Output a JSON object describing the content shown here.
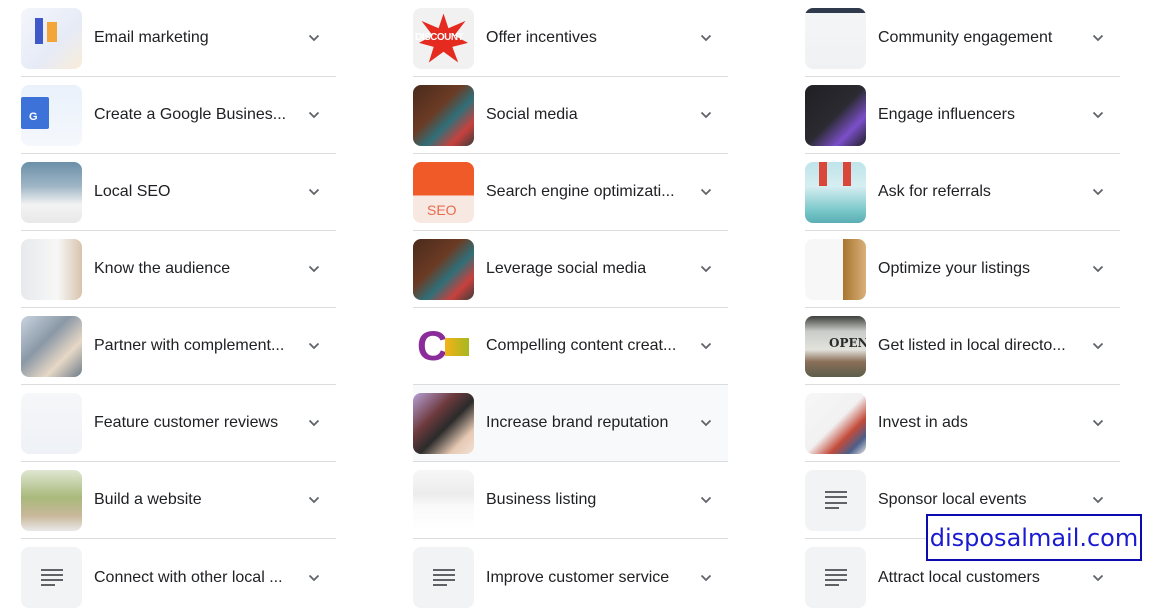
{
  "columns": [
    {
      "items": [
        {
          "label": "Email marketing",
          "thumbnail": "email-marketing-illustration"
        },
        {
          "label": "Create a Google Busines...",
          "thumbnail": "google-business-profile-logo"
        },
        {
          "label": "Local SEO",
          "thumbnail": "local-seo-video"
        },
        {
          "label": "Know the audience",
          "thumbnail": "audience-charts"
        },
        {
          "label": "Partner with complement...",
          "thumbnail": "people-handshake-photo"
        },
        {
          "label": "Feature customer reviews",
          "thumbnail": "reviews-screenshot"
        },
        {
          "label": "Build a website",
          "thumbnail": "website-screenshot"
        },
        {
          "label": "Connect with other local ...",
          "thumbnail": "document-icon"
        }
      ]
    },
    {
      "items": [
        {
          "label": "Offer incentives",
          "thumbnail": "special-discount-badge",
          "badge_text": "DISCOUNT"
        },
        {
          "label": "Social media",
          "thumbnail": "phone-social-apps"
        },
        {
          "label": "Search engine optimizati...",
          "thumbnail": "seo-guide-banner",
          "badge_text": "SEO"
        },
        {
          "label": "Leverage social media",
          "thumbnail": "phone-social-apps"
        },
        {
          "label": "Compelling content creat...",
          "thumbnail": "content-creation-logo"
        },
        {
          "label": "Increase brand reputation",
          "thumbnail": "brand-laptop-photo",
          "hovered": true
        },
        {
          "label": "Business listing",
          "thumbnail": "business-listing-screenshot"
        },
        {
          "label": "Improve customer service",
          "thumbnail": "document-icon"
        }
      ]
    },
    {
      "items": [
        {
          "label": "Community engagement",
          "thumbnail": "community-screenshot"
        },
        {
          "label": "Engage influencers",
          "thumbnail": "influencer-phone-illustration"
        },
        {
          "label": "Ask for referrals",
          "thumbnail": "referral-megaphones"
        },
        {
          "label": "Optimize your listings",
          "thumbnail": "listing-screenshot"
        },
        {
          "label": "Get listed in local directo...",
          "thumbnail": "open-sign-photo",
          "badge_text": "OPEN"
        },
        {
          "label": "Invest in ads",
          "thumbnail": "ads-brochure"
        },
        {
          "label": "Sponsor local events",
          "thumbnail": "document-icon"
        },
        {
          "label": "Attract local customers",
          "thumbnail": "document-icon"
        }
      ]
    }
  ],
  "watermark": {
    "text": "disposalmail.com",
    "color": "#1a1ad0"
  }
}
